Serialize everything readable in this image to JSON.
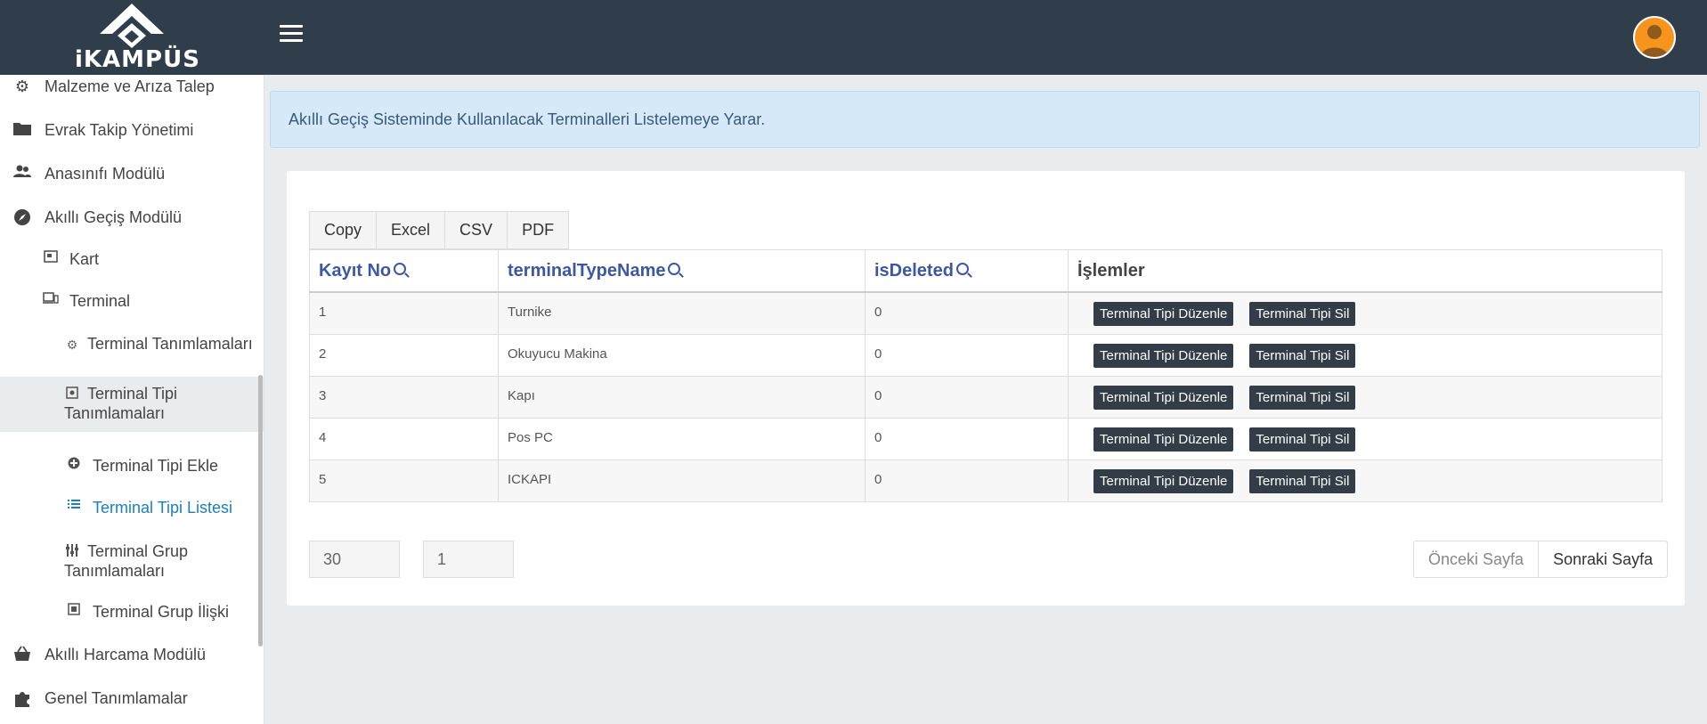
{
  "brand": {
    "logo_text": "iKAMPÜS"
  },
  "sidebar": {
    "items": [
      {
        "label": "Malzeme ve Arıza Talep",
        "icon": "gear-icon"
      },
      {
        "label": "Evrak Takip Yönetimi",
        "icon": "folder-icon"
      },
      {
        "label": "Anasınıfı Modülü",
        "icon": "users-icon"
      },
      {
        "label": "Akıllı Geçiş Modülü",
        "icon": "compass-icon"
      },
      {
        "label": "Kart",
        "icon": "card-icon"
      },
      {
        "label": "Terminal",
        "icon": "devices-icon"
      },
      {
        "label": "Terminal Tanımlamaları",
        "icon": "gear-icon"
      },
      {
        "label": "Terminal Tipi Tanımlamaları",
        "icon": "settings-box-icon"
      },
      {
        "label": "Terminal Tipi Ekle",
        "icon": "plus-circle-icon"
      },
      {
        "label": "Terminal Tipi Listesi",
        "icon": "list-icon"
      },
      {
        "label": "Terminal Grup Tanımlamaları",
        "icon": "sliders-icon"
      },
      {
        "label": "Terminal Grup İlişki",
        "icon": "link-box-icon"
      },
      {
        "label": "Akıllı Harcama Modülü",
        "icon": "basket-icon"
      },
      {
        "label": "Genel Tanımlamalar",
        "icon": "puzzle-icon"
      }
    ]
  },
  "alert": {
    "text": "Akıllı Geçiş Sisteminde Kullanılacak Terminalleri Listelemeye Yarar."
  },
  "export_buttons": [
    "Copy",
    "Excel",
    "CSV",
    "PDF"
  ],
  "table": {
    "columns": [
      "Kayıt No",
      "terminalTypeName",
      "isDeleted",
      "İşlemler"
    ],
    "rows": [
      {
        "id": "1",
        "name": "Turnike",
        "deleted": "0"
      },
      {
        "id": "2",
        "name": "Okuyucu Makina",
        "deleted": "0"
      },
      {
        "id": "3",
        "name": "Kapı",
        "deleted": "0"
      },
      {
        "id": "4",
        "name": "Pos PC",
        "deleted": "0"
      },
      {
        "id": "5",
        "name": "ICKAPI",
        "deleted": "0"
      }
    ],
    "edit_label": "Terminal Tipi Düzenle",
    "delete_label": "Terminal Tipi Sil"
  },
  "pagination": {
    "page_size": "30",
    "page_number": "1",
    "prev_label": "Önceki Sayfa",
    "next_label": "Sonraki Sayfa"
  }
}
